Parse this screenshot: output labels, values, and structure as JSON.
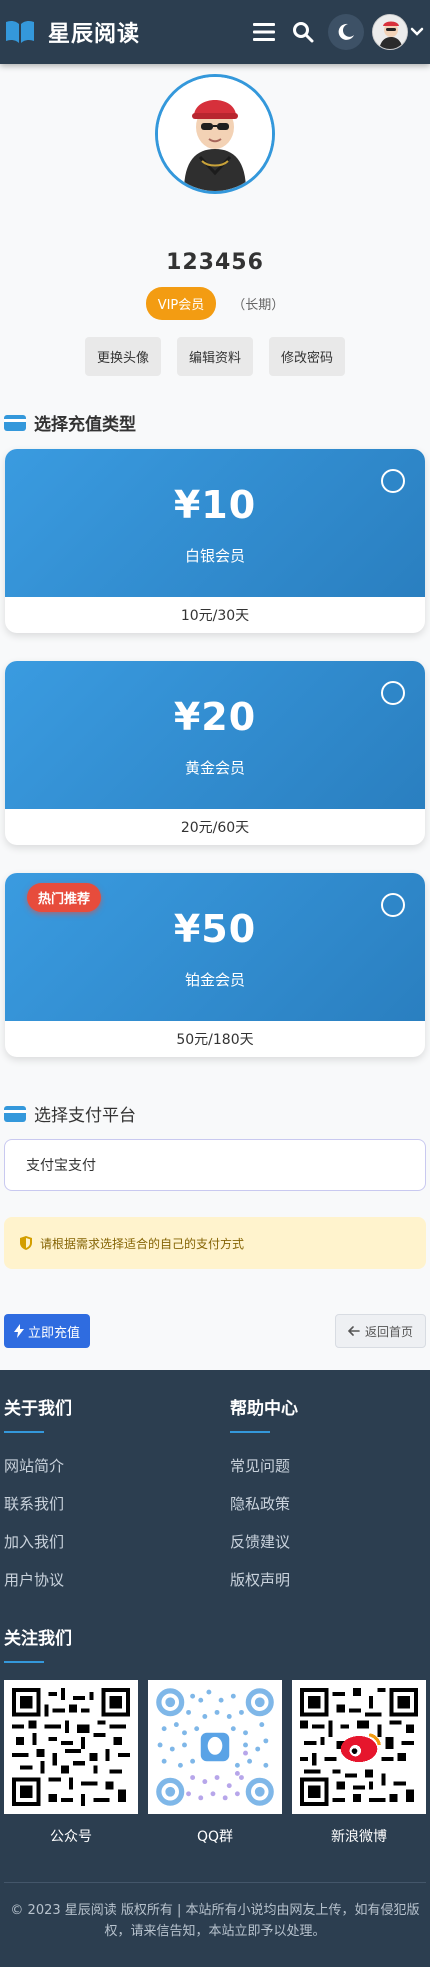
{
  "header": {
    "site_name": "星辰阅读",
    "icons": {
      "logo": "open-book-icon",
      "menu": "hamburger-menu-icon",
      "search": "search-icon",
      "theme": "moon-icon",
      "dropdown": "chevron-down-icon"
    }
  },
  "profile": {
    "username": "123456",
    "vip_label": "VIP会员",
    "vip_duration": "（长期）",
    "buttons": [
      "更换头像",
      "编辑资料",
      "修改密码"
    ]
  },
  "recharge": {
    "section_title": "选择充值类型",
    "plans": [
      {
        "price": "¥10",
        "name": "白银会员",
        "desc": "10元/30天",
        "badge": ""
      },
      {
        "price": "¥20",
        "name": "黄金会员",
        "desc": "20元/60天",
        "badge": ""
      },
      {
        "price": "¥50",
        "name": "铂金会员",
        "desc": "50元/180天",
        "badge": "热门推荐"
      }
    ]
  },
  "payment": {
    "section_title": "选择支付平台",
    "selected": "支付宝支付",
    "notice": "请根据需求选择适合的自己的支付方式",
    "submit_label": "立即充值",
    "back_label": "返回首页"
  },
  "footer": {
    "about_title": "关于我们",
    "about_links": [
      "网站简介",
      "联系我们",
      "加入我们",
      "用户协议"
    ],
    "help_title": "帮助中心",
    "help_links": [
      "常见问题",
      "隐私政策",
      "反馈建议",
      "版权声明"
    ],
    "follow_title": "关注我们",
    "qr_codes": [
      {
        "label": "公众号"
      },
      {
        "label": "QQ群"
      },
      {
        "label": "新浪微博"
      }
    ],
    "copyright": "© 2023 星辰阅读 版权所有 | 本站所有小说均由网友上传，如有侵犯版权，请来信告知，本站立即予以处理。"
  },
  "colors": {
    "header_bg": "#2c3e50",
    "accent": "#3498db",
    "vip": "#f39c12",
    "hot": "#e74c3c",
    "primary_button": "#2f6ce0"
  }
}
